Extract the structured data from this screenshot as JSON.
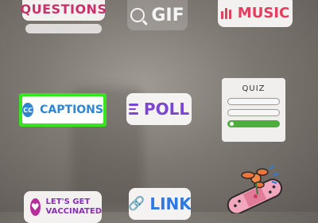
{
  "stickers": {
    "questions": {
      "label": "QUESTIONS"
    },
    "gif": {
      "label": "GIF"
    },
    "music": {
      "label": "MUSIC"
    },
    "captions": {
      "icon_text": "CC",
      "label": "CAPTIONS"
    },
    "poll": {
      "label": "POLL"
    },
    "quiz": {
      "title": "QUIZ"
    },
    "vaccine": {
      "line1": "LET'S GET",
      "line2": "VACCINATED"
    },
    "link": {
      "label": "LINK"
    }
  },
  "colors": {
    "highlight": "#37e51d",
    "captions": "#2c86d3",
    "poll": "#7b45d6",
    "music": "#e0405d",
    "questions": "#c8316a",
    "link": "#2f7ae0",
    "quiz_correct": "#4caf3d"
  },
  "icons": [
    "search-icon",
    "music-bars-icon",
    "cc-icon",
    "poll-lines-icon",
    "heart-icon",
    "link-icon",
    "bandage-sticker"
  ]
}
